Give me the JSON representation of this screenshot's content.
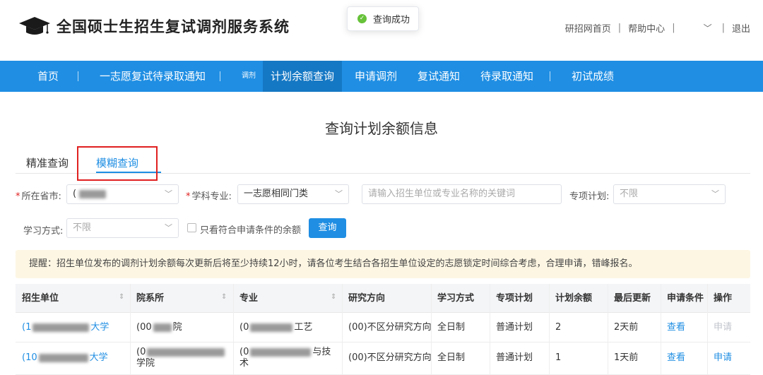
{
  "header": {
    "site_title": "全国硕士生招生复试调剂服务系统",
    "toast": "查询成功",
    "links": [
      "研招网首页",
      "帮助中心",
      "退出"
    ]
  },
  "nav": {
    "items": [
      "首页",
      "一志愿复试待录取通知",
      "调剂",
      "计划余额查询",
      "申请调剂",
      "复试通知",
      "待录取通知",
      "初试成绩"
    ],
    "active": "计划余额查询"
  },
  "page_heading": "查询计划余额信息",
  "tabs": [
    "精准查询",
    "模糊查询"
  ],
  "filters": {
    "province_label": "所在省市:",
    "province_prefix": "(",
    "subject_label": "学科专业:",
    "subject_value": "一志愿相同门类",
    "keyword_placeholder": "请输入招生单位或专业名称的关键词",
    "special_label": "专项计划:",
    "special_value": "不限",
    "mode_label": "学习方式:",
    "mode_value": "不限",
    "checkbox_label": "只看符合申请条件的余额",
    "query_button": "查询"
  },
  "notice": "提醒：招生单位发布的调剂计划余额每次更新后将至少持续12小时，请各位考生结合各招生单位设定的志愿锁定时间综合考虑，合理申请，错峰报名。",
  "table": {
    "headers": [
      "招生单位",
      "院系所",
      "专业",
      "研究方向",
      "学习方式",
      "专项计划",
      "计划余额",
      "最后更新",
      "申请条件",
      "操作"
    ],
    "rows": [
      {
        "unit_a": "(1",
        "unit_b": "大学",
        "dept_a": "(00",
        "dept_b": "院",
        "dept_c": "",
        "major_a": "(0",
        "major_b": "工艺",
        "major_c": "",
        "direction": "(00)不区分研究方向",
        "mode": "全日制",
        "special": "普通计划",
        "remaining": "2",
        "updated": "2天前",
        "condition": "查看",
        "action": "申请"
      },
      {
        "unit_a": "(10",
        "unit_b": "大学",
        "dept_a": "(0",
        "dept_b": "",
        "dept_c": "学院",
        "major_a": "(0",
        "major_b": "与技",
        "major_c": "术",
        "direction": "(00)不区分研究方向",
        "mode": "全日制",
        "special": "普通计划",
        "remaining": "1",
        "updated": "1天前",
        "condition": "查看",
        "action": "申请"
      }
    ]
  },
  "colors": {
    "primary": "#1f8ee3",
    "nav_active": "#1578c4",
    "highlight": "#e02020",
    "notice_bg": "#fdf6e3",
    "success": "#67c23a"
  }
}
